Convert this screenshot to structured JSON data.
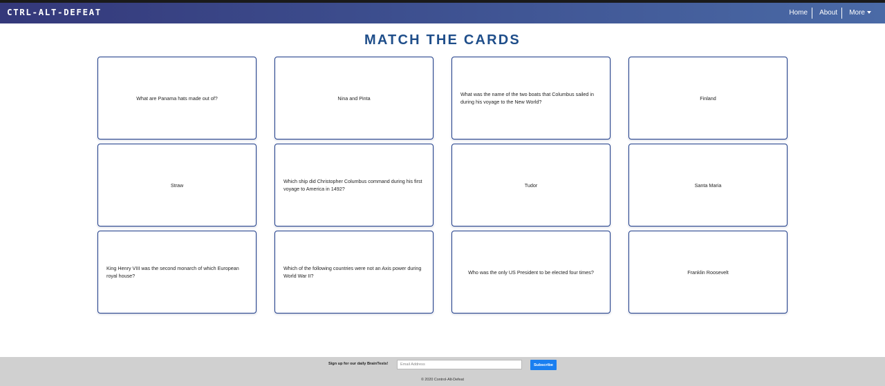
{
  "nav": {
    "brand": "CTRL-ALT-DEFEAT",
    "links": [
      "Home",
      "About",
      "More"
    ],
    "more_icon": "chevron-down-icon"
  },
  "page": {
    "title": "MATCH THE CARDS"
  },
  "cards": [
    "What are Panama hats made out of?",
    "Nina and Pinta",
    "What was the name of the two boats that Columbus sailed in during his voyage to the New World?",
    "Finland",
    "Straw",
    "Which ship did Christopher Columbus command during his first voyage to America in 1492?",
    "Tudor",
    "Santa Maria",
    "King Henry VIII was the second monarch of which European royal house?",
    "Which of the following countries were not an Axis power during World War II?",
    "Who was the only US President to be elected four times?",
    "Franklin Roosevelt"
  ],
  "footer": {
    "signup_label": "Sign up for our daily BrainTests!",
    "email_placeholder": "Email Address",
    "email_value": "",
    "subscribe_label": "Subscribe",
    "copyright": "© 2020 Control-Alt-Defeat"
  },
  "colors": {
    "nav_gradient_start": "#34387a",
    "nav_gradient_end": "#4a6aa6",
    "title": "#1f4e8a",
    "card_border": "#1f3d8a",
    "subscribe_button": "#1a7ff0",
    "footer_bg": "#d0d0d0"
  }
}
